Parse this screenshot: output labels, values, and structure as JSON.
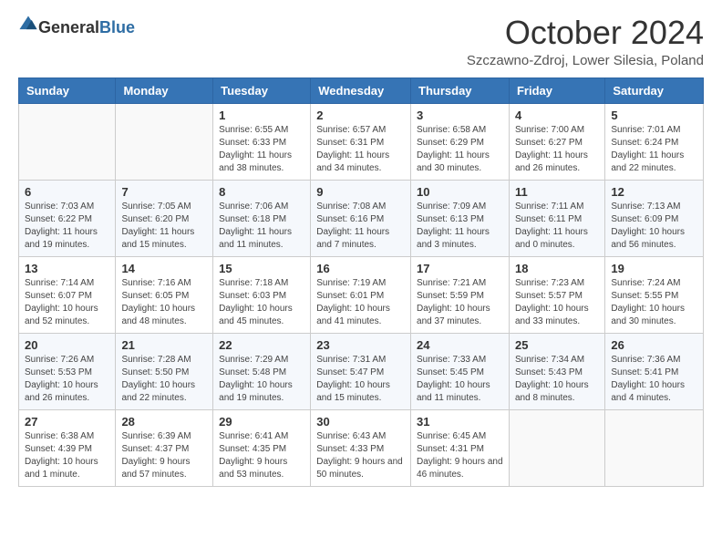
{
  "header": {
    "logo_general": "General",
    "logo_blue": "Blue",
    "month_title": "October 2024",
    "location": "Szczawno-Zdroj, Lower Silesia, Poland"
  },
  "days_of_week": [
    "Sunday",
    "Monday",
    "Tuesday",
    "Wednesday",
    "Thursday",
    "Friday",
    "Saturday"
  ],
  "weeks": [
    [
      {
        "day": "",
        "sunrise": "",
        "sunset": "",
        "daylight": ""
      },
      {
        "day": "",
        "sunrise": "",
        "sunset": "",
        "daylight": ""
      },
      {
        "day": "1",
        "sunrise": "Sunrise: 6:55 AM",
        "sunset": "Sunset: 6:33 PM",
        "daylight": "Daylight: 11 hours and 38 minutes."
      },
      {
        "day": "2",
        "sunrise": "Sunrise: 6:57 AM",
        "sunset": "Sunset: 6:31 PM",
        "daylight": "Daylight: 11 hours and 34 minutes."
      },
      {
        "day": "3",
        "sunrise": "Sunrise: 6:58 AM",
        "sunset": "Sunset: 6:29 PM",
        "daylight": "Daylight: 11 hours and 30 minutes."
      },
      {
        "day": "4",
        "sunrise": "Sunrise: 7:00 AM",
        "sunset": "Sunset: 6:27 PM",
        "daylight": "Daylight: 11 hours and 26 minutes."
      },
      {
        "day": "5",
        "sunrise": "Sunrise: 7:01 AM",
        "sunset": "Sunset: 6:24 PM",
        "daylight": "Daylight: 11 hours and 22 minutes."
      }
    ],
    [
      {
        "day": "6",
        "sunrise": "Sunrise: 7:03 AM",
        "sunset": "Sunset: 6:22 PM",
        "daylight": "Daylight: 11 hours and 19 minutes."
      },
      {
        "day": "7",
        "sunrise": "Sunrise: 7:05 AM",
        "sunset": "Sunset: 6:20 PM",
        "daylight": "Daylight: 11 hours and 15 minutes."
      },
      {
        "day": "8",
        "sunrise": "Sunrise: 7:06 AM",
        "sunset": "Sunset: 6:18 PM",
        "daylight": "Daylight: 11 hours and 11 minutes."
      },
      {
        "day": "9",
        "sunrise": "Sunrise: 7:08 AM",
        "sunset": "Sunset: 6:16 PM",
        "daylight": "Daylight: 11 hours and 7 minutes."
      },
      {
        "day": "10",
        "sunrise": "Sunrise: 7:09 AM",
        "sunset": "Sunset: 6:13 PM",
        "daylight": "Daylight: 11 hours and 3 minutes."
      },
      {
        "day": "11",
        "sunrise": "Sunrise: 7:11 AM",
        "sunset": "Sunset: 6:11 PM",
        "daylight": "Daylight: 11 hours and 0 minutes."
      },
      {
        "day": "12",
        "sunrise": "Sunrise: 7:13 AM",
        "sunset": "Sunset: 6:09 PM",
        "daylight": "Daylight: 10 hours and 56 minutes."
      }
    ],
    [
      {
        "day": "13",
        "sunrise": "Sunrise: 7:14 AM",
        "sunset": "Sunset: 6:07 PM",
        "daylight": "Daylight: 10 hours and 52 minutes."
      },
      {
        "day": "14",
        "sunrise": "Sunrise: 7:16 AM",
        "sunset": "Sunset: 6:05 PM",
        "daylight": "Daylight: 10 hours and 48 minutes."
      },
      {
        "day": "15",
        "sunrise": "Sunrise: 7:18 AM",
        "sunset": "Sunset: 6:03 PM",
        "daylight": "Daylight: 10 hours and 45 minutes."
      },
      {
        "day": "16",
        "sunrise": "Sunrise: 7:19 AM",
        "sunset": "Sunset: 6:01 PM",
        "daylight": "Daylight: 10 hours and 41 minutes."
      },
      {
        "day": "17",
        "sunrise": "Sunrise: 7:21 AM",
        "sunset": "Sunset: 5:59 PM",
        "daylight": "Daylight: 10 hours and 37 minutes."
      },
      {
        "day": "18",
        "sunrise": "Sunrise: 7:23 AM",
        "sunset": "Sunset: 5:57 PM",
        "daylight": "Daylight: 10 hours and 33 minutes."
      },
      {
        "day": "19",
        "sunrise": "Sunrise: 7:24 AM",
        "sunset": "Sunset: 5:55 PM",
        "daylight": "Daylight: 10 hours and 30 minutes."
      }
    ],
    [
      {
        "day": "20",
        "sunrise": "Sunrise: 7:26 AM",
        "sunset": "Sunset: 5:53 PM",
        "daylight": "Daylight: 10 hours and 26 minutes."
      },
      {
        "day": "21",
        "sunrise": "Sunrise: 7:28 AM",
        "sunset": "Sunset: 5:50 PM",
        "daylight": "Daylight: 10 hours and 22 minutes."
      },
      {
        "day": "22",
        "sunrise": "Sunrise: 7:29 AM",
        "sunset": "Sunset: 5:48 PM",
        "daylight": "Daylight: 10 hours and 19 minutes."
      },
      {
        "day": "23",
        "sunrise": "Sunrise: 7:31 AM",
        "sunset": "Sunset: 5:47 PM",
        "daylight": "Daylight: 10 hours and 15 minutes."
      },
      {
        "day": "24",
        "sunrise": "Sunrise: 7:33 AM",
        "sunset": "Sunset: 5:45 PM",
        "daylight": "Daylight: 10 hours and 11 minutes."
      },
      {
        "day": "25",
        "sunrise": "Sunrise: 7:34 AM",
        "sunset": "Sunset: 5:43 PM",
        "daylight": "Daylight: 10 hours and 8 minutes."
      },
      {
        "day": "26",
        "sunrise": "Sunrise: 7:36 AM",
        "sunset": "Sunset: 5:41 PM",
        "daylight": "Daylight: 10 hours and 4 minutes."
      }
    ],
    [
      {
        "day": "27",
        "sunrise": "Sunrise: 6:38 AM",
        "sunset": "Sunset: 4:39 PM",
        "daylight": "Daylight: 10 hours and 1 minute."
      },
      {
        "day": "28",
        "sunrise": "Sunrise: 6:39 AM",
        "sunset": "Sunset: 4:37 PM",
        "daylight": "Daylight: 9 hours and 57 minutes."
      },
      {
        "day": "29",
        "sunrise": "Sunrise: 6:41 AM",
        "sunset": "Sunset: 4:35 PM",
        "daylight": "Daylight: 9 hours and 53 minutes."
      },
      {
        "day": "30",
        "sunrise": "Sunrise: 6:43 AM",
        "sunset": "Sunset: 4:33 PM",
        "daylight": "Daylight: 9 hours and 50 minutes."
      },
      {
        "day": "31",
        "sunrise": "Sunrise: 6:45 AM",
        "sunset": "Sunset: 4:31 PM",
        "daylight": "Daylight: 9 hours and 46 minutes."
      },
      {
        "day": "",
        "sunrise": "",
        "sunset": "",
        "daylight": ""
      },
      {
        "day": "",
        "sunrise": "",
        "sunset": "",
        "daylight": ""
      }
    ]
  ]
}
